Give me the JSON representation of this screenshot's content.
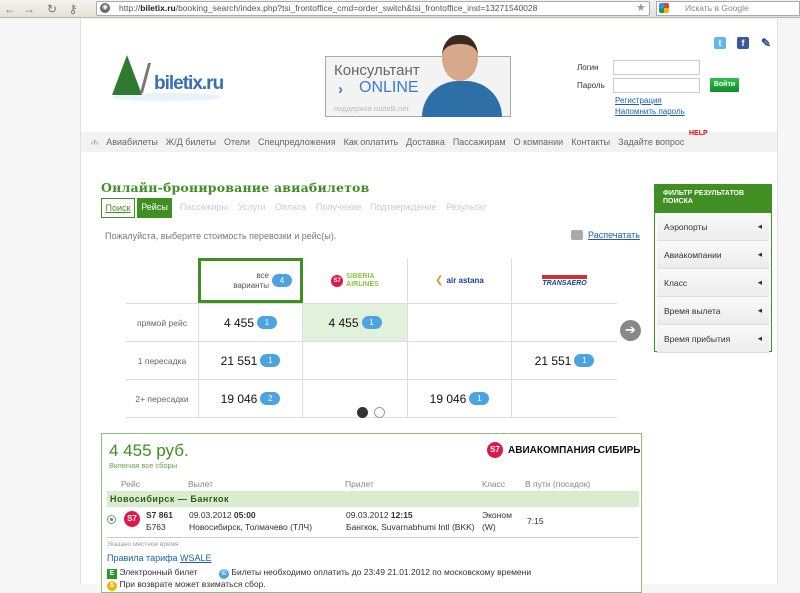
{
  "browser": {
    "url_prefix": "http://",
    "url_host": "biletix.ru",
    "url_path": "/booking_search/index.php?tsi_frontoffice_cmd=order_switch&tsi_frontoffice_inst=13271540028",
    "search_placeholder": "Искать в Google"
  },
  "header": {
    "logo_text": "biletix.ru",
    "consultant": {
      "title": "Консультант",
      "status": "ONLINE",
      "support": "поддержка rustalk.net"
    },
    "login": {
      "login_label": "Логин",
      "password_label": "Пароль",
      "submit": "Войти",
      "register": "Регистрация",
      "remind": "Напомнить пароль"
    }
  },
  "nav": {
    "items": [
      "Авиабилеты",
      "Ж/Д билеты",
      "Отели",
      "Спецпредложения",
      "Как оплатить",
      "Доставка",
      "Пассажирам",
      "О компании",
      "Контакты",
      "Задайте вопрос"
    ],
    "help_badge": "HELP"
  },
  "main": {
    "title": "Онлайн-бронирование авиабилетов",
    "steps": [
      "Поиск",
      "Рейсы",
      "Пассажиры",
      "Услуги",
      "Оплата",
      "Получение",
      "Подтверждение",
      "Результат"
    ],
    "instruction": "Пожалуйста, выберите стоимость перевозки и рейс(ы).",
    "print": "Распечатать"
  },
  "matrix": {
    "all": {
      "label1": "все",
      "label2": "варианты",
      "count": "4"
    },
    "airlines": [
      {
        "name1": "SIBERIA",
        "name2": "AIRLINES",
        "color": "#8cc63f"
      },
      {
        "name": "air astana",
        "color": "#1c3f94"
      },
      {
        "name": "TRANSAERO",
        "color": "#1c3f94"
      }
    ],
    "rows": [
      {
        "label": "прямой рейс",
        "cells": [
          {
            "price": "4 455",
            "count": "1"
          },
          {
            "price": "4 455",
            "count": "1"
          },
          null,
          null
        ]
      },
      {
        "label": "1 пересадка",
        "cells": [
          {
            "price": "21 551",
            "count": "1"
          },
          null,
          null,
          {
            "price": "21 551",
            "count": "1"
          }
        ]
      },
      {
        "label": "2+ пересадки",
        "cells": [
          {
            "price": "19 046",
            "count": "2"
          },
          null,
          {
            "price": "19 046",
            "count": "1"
          },
          null
        ]
      }
    ]
  },
  "filter": {
    "title": "ФИЛЬТР РЕЗУЛЬТАТОВ ПОИСКА",
    "items": [
      "Аэропорты",
      "Авиакомпании",
      "Класс",
      "Время вылета",
      "Время прибытия"
    ]
  },
  "result": {
    "price": "4 455 руб.",
    "included": "Включая все сборы",
    "airline": "АВИАКОМПАНИЯ СИБИРЬ",
    "s7": "S7",
    "columns": [
      "Рейс",
      "Вылет",
      "Прилет",
      "Класс",
      "В пути (посадок)"
    ],
    "route": "Новосибирск — Бангкок",
    "flight": {
      "number": "S7 861",
      "aircraft": "Б763",
      "dep_date": "09.03.2012",
      "dep_time": "05:00",
      "dep_place": "Новосибирск, Толмачево (ТЛЧ)",
      "arr_date": "09.03.2012",
      "arr_time": "12:15",
      "arr_place": "Бангкок, Suvarnabhumi Intl (BKK)",
      "class1": "Эконом",
      "class2": "(W)",
      "duration": "7:15"
    },
    "local_time": "Указано местное время",
    "fare_rules": "Правила тарифа",
    "fare_code": "WSALE",
    "eticket": "Электронный билет",
    "pay_deadline": "Билеты необходимо оплатить до 23:49 21.01.2012 по московскому времени",
    "refund": "При возврате может взиматься сбор."
  }
}
